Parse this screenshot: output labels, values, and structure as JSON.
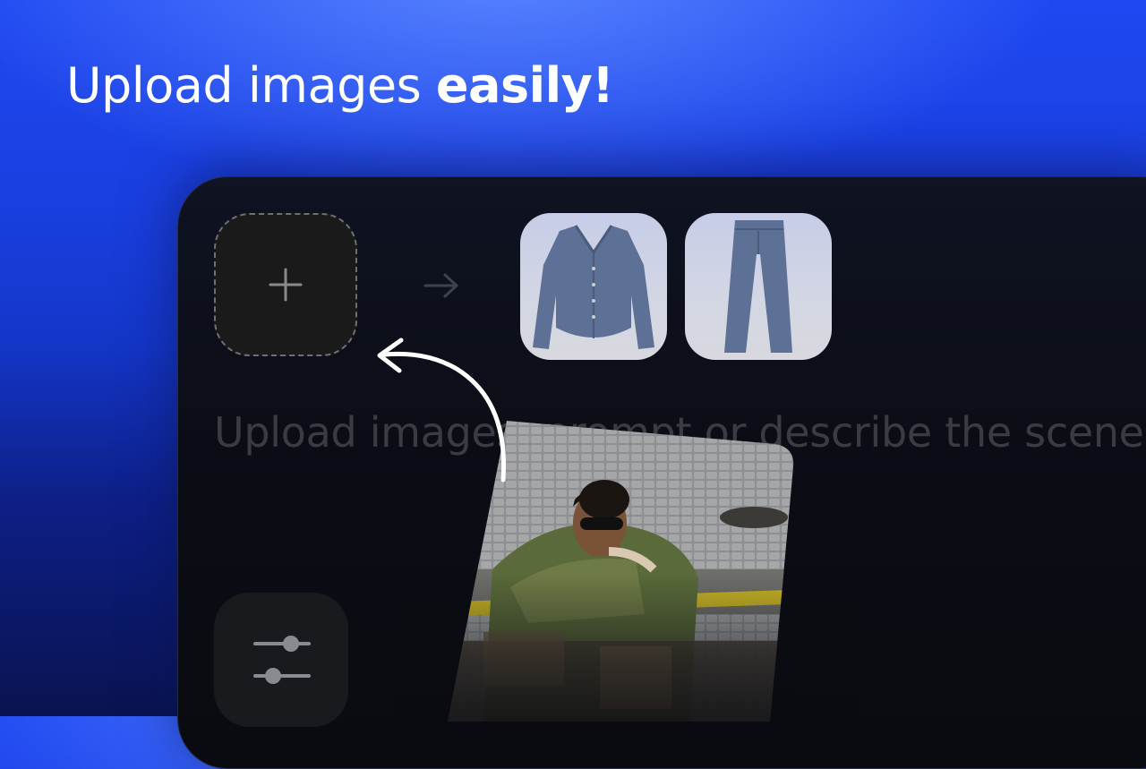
{
  "headline": {
    "regular": "Upload images ",
    "bold": "easily!"
  },
  "editor": {
    "upload_slot_icon": "plus-icon",
    "arrow_icon": "arrow-right-icon",
    "thumbnails": [
      {
        "icon": "cardigan-thumbnail"
      },
      {
        "icon": "trousers-thumbnail"
      }
    ],
    "prompt_placeholder": "Upload images, prompt or describe the scene",
    "settings_icon": "sliders-icon"
  },
  "overlay": {
    "pointer_icon": "curved-arrow-icon",
    "photo": "street-photo-card"
  },
  "colors": {
    "accent_blue": "#1a3fe0",
    "panel": "#0b0d16",
    "dashed_border": "#707070",
    "placeholder_text": "#3a3c42"
  }
}
